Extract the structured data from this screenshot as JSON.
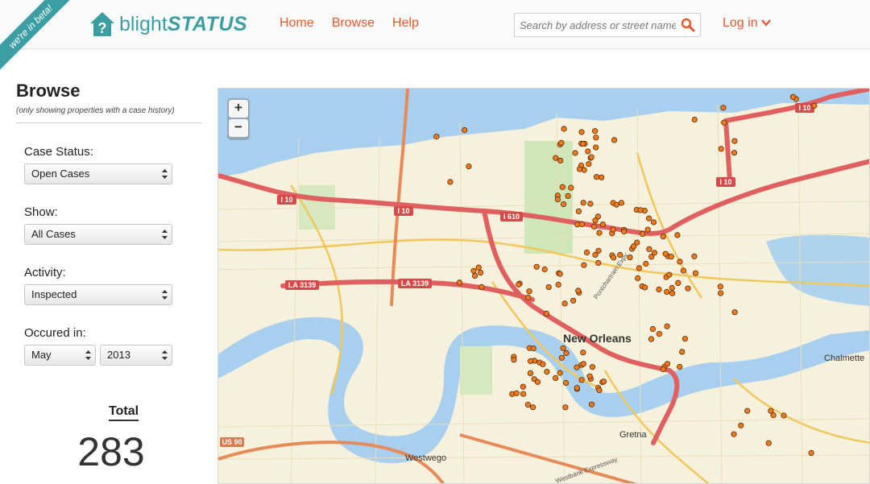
{
  "header": {
    "beta_ribbon": "we're in beta!",
    "logo_part1": "blight",
    "logo_part2": "STATUS",
    "nav": [
      "Home",
      "Browse",
      "Help"
    ],
    "search_placeholder": "Search by address or street name",
    "login_label": "Log in"
  },
  "sidebar": {
    "title": "Browse",
    "subtitle": "(only showing properties with a case history)",
    "case_status_label": "Case Status:",
    "case_status_value": "Open Cases",
    "show_label": "Show:",
    "show_value": "All Cases",
    "activity_label": "Activity:",
    "activity_value": "Inspected",
    "occured_label": "Occured in:",
    "month_value": "May",
    "year_value": "2013",
    "total_label": "Total",
    "total_value": "283"
  },
  "map": {
    "zoom_in": "+",
    "zoom_out": "−",
    "labels": {
      "city": "New Orleans",
      "westwego": "Westwego",
      "gretna": "Gretna",
      "chalmette": "Chalmette",
      "hwy_i10_a": "I 10",
      "hwy_i10_b": "I 10",
      "hwy_i10_c": "I 10",
      "hwy_i10_d": "I 10",
      "hwy_i610": "I 610",
      "hwy_la3139_a": "LA 3139",
      "hwy_la3139_b": "LA 3139",
      "hwy_us90": "US 90",
      "pontchartrain": "Pontchartrain Expy",
      "westbank": "Westbank Expressway"
    },
    "colors": {
      "water": "#a8cfee",
      "land": "#f6f1dc",
      "marker": "#f07b1e",
      "highway": "#e06060",
      "accent": "#3b9ea3",
      "link": "#e4572e"
    }
  }
}
